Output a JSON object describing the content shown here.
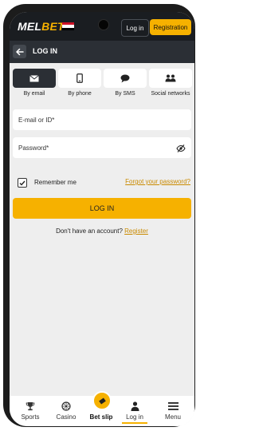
{
  "topbar": {
    "logo_part1": "MEL",
    "logo_part2": "BET",
    "login_label": "Log in",
    "register_label": "Registration"
  },
  "header": {
    "title": "LOG IN"
  },
  "tabs": [
    {
      "label": "By email",
      "icon": "envelope-icon",
      "active": true
    },
    {
      "label": "By phone",
      "icon": "phone-icon",
      "active": false
    },
    {
      "label": "By SMS",
      "icon": "chat-bubble-icon",
      "active": false
    },
    {
      "label": "Social networks",
      "icon": "people-icon",
      "active": false
    }
  ],
  "form": {
    "email_placeholder": "E-mail or ID*",
    "password_placeholder": "Password*",
    "remember_label": "Remember me",
    "remember_checked": true,
    "forgot_label": "Forgot your password?",
    "submit_label": "LOG IN",
    "no_account_text": "Don't have an account?",
    "register_link": "Register"
  },
  "bottom_nav": [
    {
      "label": "Sports",
      "icon": "trophy-icon"
    },
    {
      "label": "Casino",
      "icon": "roulette-icon"
    },
    {
      "label": "Bet slip",
      "icon": "ticket-icon"
    },
    {
      "label": "Log in",
      "icon": "person-icon",
      "active": true
    },
    {
      "label": "Menu",
      "icon": "menu-icon"
    }
  ],
  "colors": {
    "accent": "#f6b100",
    "topbar": "#1a1d21",
    "header": "#2b2f35",
    "background": "#eeeeee"
  }
}
